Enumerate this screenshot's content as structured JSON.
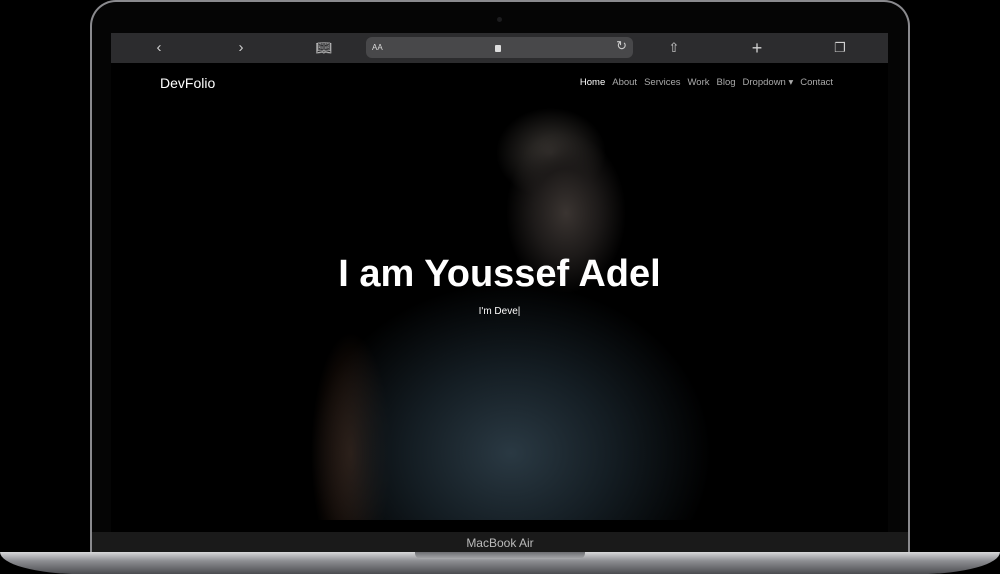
{
  "device": {
    "label": "MacBook Air"
  },
  "browser": {
    "url_text_size": "AA",
    "icons": [
      "chevron-left-icon",
      "chevron-right-icon",
      "book-icon",
      "lock-icon",
      "reload-icon",
      "share-icon",
      "plus-icon",
      "tabs-icon"
    ]
  },
  "site": {
    "brand": "DevFolio",
    "nav": [
      {
        "label": "Home"
      },
      {
        "label": "About"
      },
      {
        "label": "Services"
      },
      {
        "label": "Work"
      },
      {
        "label": "Blog"
      },
      {
        "label": "Dropdown ▾"
      },
      {
        "label": "Contact"
      }
    ],
    "hero": {
      "title": "I am Youssef Adel",
      "subtitle": "I'm Deve|"
    }
  }
}
